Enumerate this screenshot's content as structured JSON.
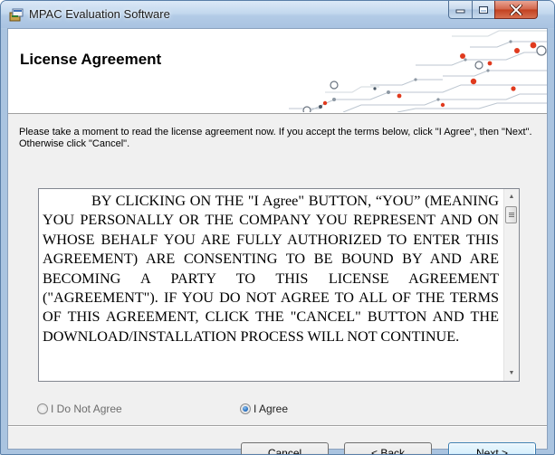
{
  "window": {
    "title": "MPAC Evaluation Software"
  },
  "header": {
    "title": "License Agreement"
  },
  "instructions": "Please take a moment to read the license agreement now. If you accept the terms below, click \"I Agree\", then \"Next\". Otherwise click \"Cancel\".",
  "license": {
    "text": "BY CLICKING ON THE \"I Agree\" BUTTON, “YOU” (MEANING YOU PERSONALLY OR THE COMPANY YOU REPRESENT AND ON WHOSE BEHALF YOU ARE FULLY AUTHORIZED TO ENTER THIS AGREEMENT) ARE CONSENTING TO BE BOUND BY AND ARE BECOMING A PARTY TO THIS LICENSE AGREEMENT (\"AGREEMENT\"). IF YOU DO NOT AGREE TO ALL OF THE TERMS OF THIS AGREEMENT, CLICK THE \"CANCEL\" BUTTON AND THE DOWNLOAD/INSTALLATION PROCESS WILL NOT CONTINUE."
  },
  "options": {
    "do_not_agree": "I Do Not Agree",
    "agree": "I Agree",
    "selected": "agree"
  },
  "buttons": {
    "cancel": "Cancel",
    "back": "< Back",
    "next": "Next >"
  },
  "colors": {
    "banner_dots": "#e03a1e",
    "banner_lines": "#b8c2cc",
    "default_button_border": "#3c7fb1"
  },
  "icons": {
    "app": "installer-package-icon",
    "minimize": "minimize-icon",
    "maximize": "maximize-icon",
    "close": "close-icon",
    "scroll_up": "scroll-up-arrow-icon",
    "scroll_down": "scroll-down-arrow-icon"
  }
}
